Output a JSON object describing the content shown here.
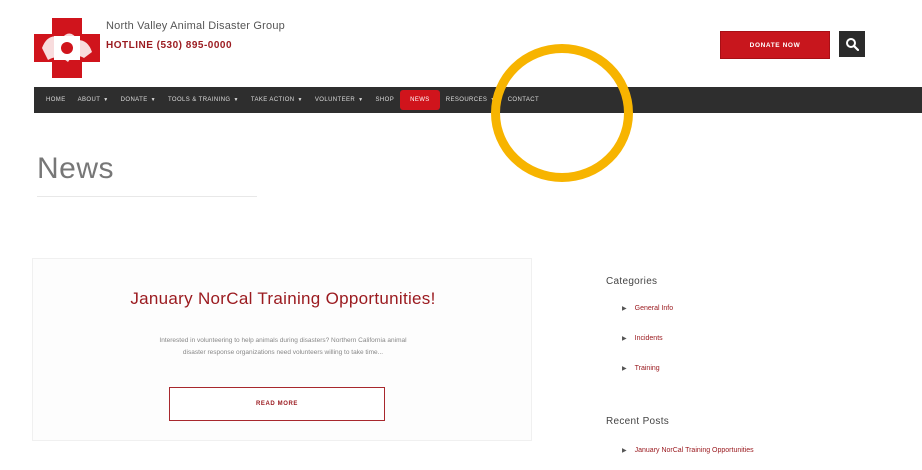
{
  "header": {
    "org_name": "North Valley Animal Disaster Group",
    "hotline": "HOTLINE (530) 895-0000",
    "donate_label": "DONATE NOW",
    "colors": {
      "brand_red": "#c8161d",
      "dark": "#2e2e2e",
      "highlight": "#f7b400"
    }
  },
  "nav": {
    "items": [
      {
        "label": "HOME",
        "has_dropdown": false
      },
      {
        "label": "ABOUT",
        "has_dropdown": true
      },
      {
        "label": "DONATE",
        "has_dropdown": true
      },
      {
        "label": "TOOLS & TRAINING",
        "has_dropdown": true
      },
      {
        "label": "TAKE ACTION",
        "has_dropdown": true
      },
      {
        "label": "VOLUNTEER",
        "has_dropdown": true
      },
      {
        "label": "SHOP",
        "has_dropdown": false
      },
      {
        "label": "NEWS",
        "has_dropdown": false,
        "active": true
      },
      {
        "label": "RESOURCES",
        "has_dropdown": true
      },
      {
        "label": "CONTACT",
        "has_dropdown": false
      }
    ]
  },
  "page": {
    "title": "News"
  },
  "post": {
    "title": "January NorCal Training Opportunities!",
    "excerpt_line1": "Interested in volunteering to help animals during disasters? Northern California animal",
    "excerpt_line2": "disaster response organizations need volunteers willing to take time...",
    "read_more_label": "READ MORE"
  },
  "sidebar": {
    "categories_heading": "Categories",
    "categories": [
      "General Info",
      "Incidents",
      "Training"
    ],
    "recent_heading": "Recent Posts",
    "recent_posts": [
      "January NorCal Training Opportunities"
    ]
  }
}
